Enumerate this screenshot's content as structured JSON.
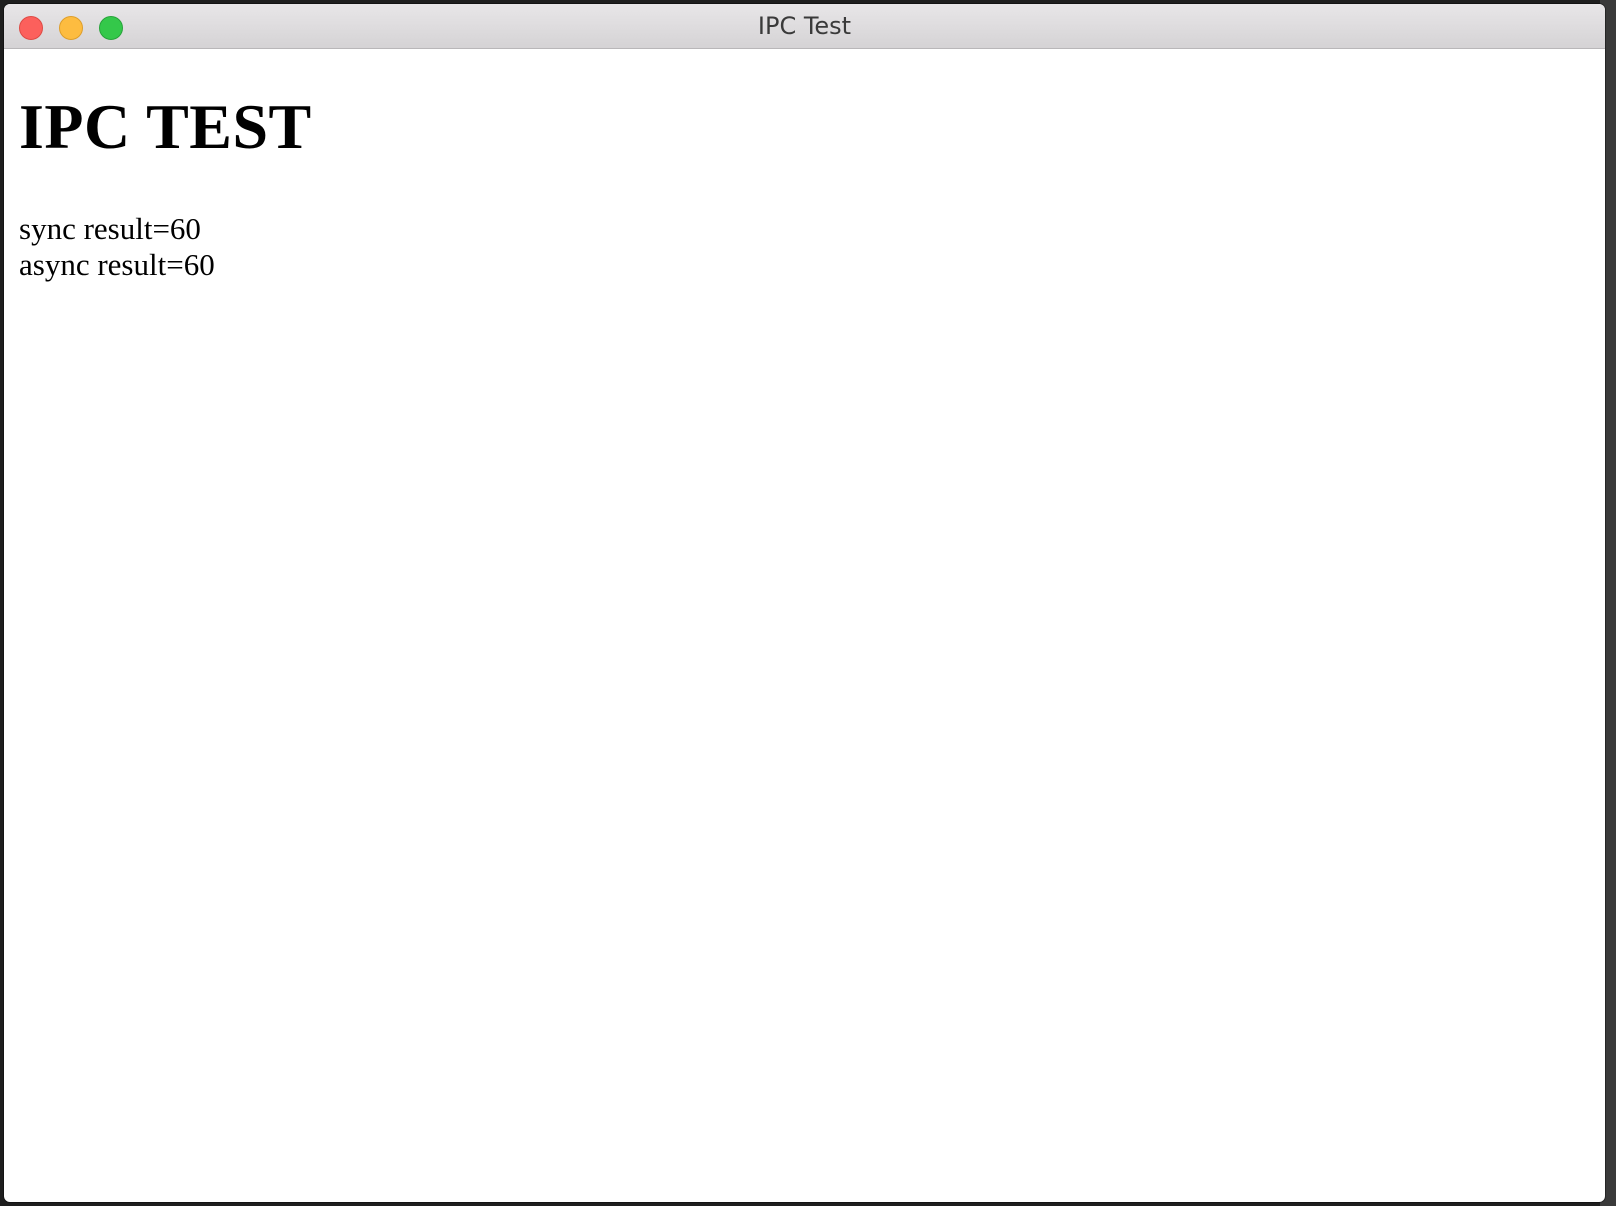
{
  "window": {
    "title": "IPC Test",
    "controls": {
      "close": "close-button",
      "minimize": "minimize-button",
      "zoom": "zoom-button"
    }
  },
  "page": {
    "heading": "IPC TEST",
    "results": [
      "sync result=60",
      "async result=60"
    ]
  },
  "colors": {
    "close": "#fc605c",
    "minimize": "#fdbc40",
    "zoom": "#34c84a",
    "titlebar": "#dcdadc",
    "content_bg": "#ffffff"
  }
}
